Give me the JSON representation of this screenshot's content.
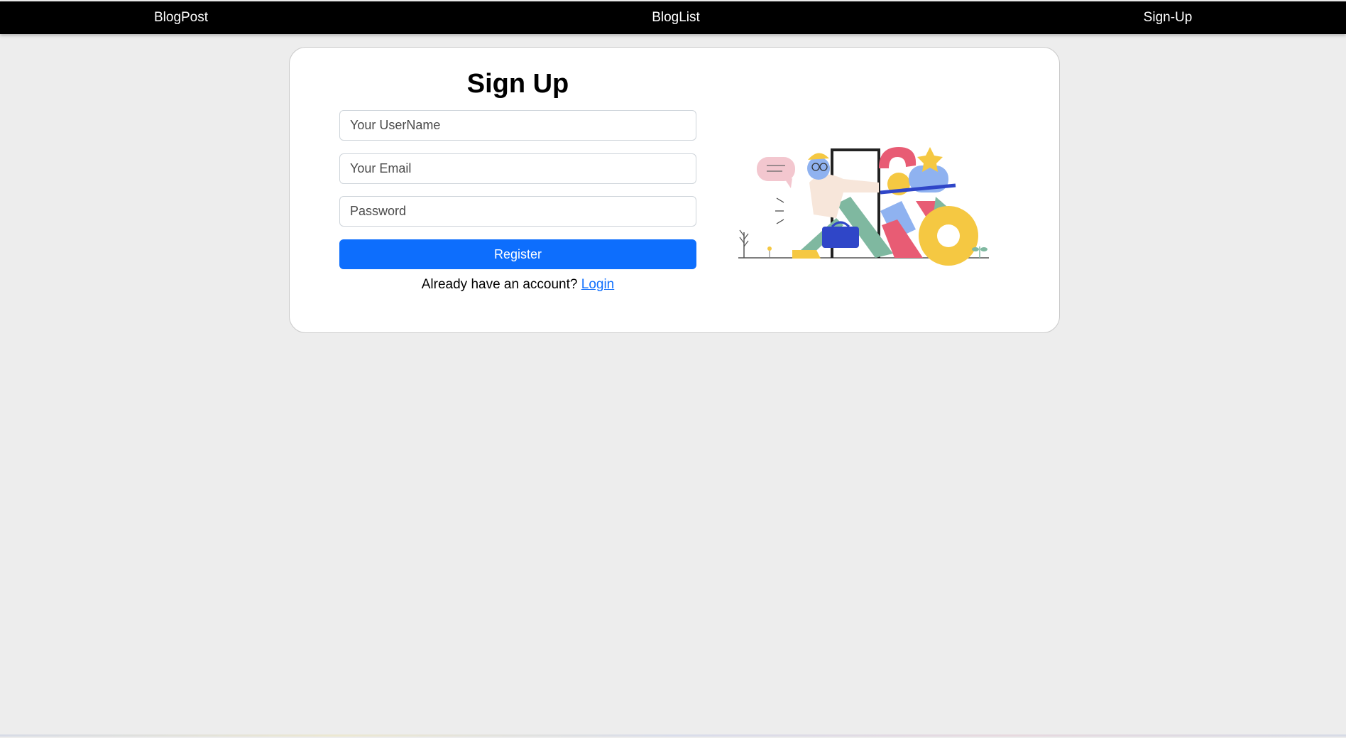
{
  "navbar": {
    "brand": "BlogPost",
    "link_bloglist": "BlogList",
    "link_signup": "Sign-Up"
  },
  "signup": {
    "title": "Sign Up",
    "username_placeholder": "Your UserName",
    "email_placeholder": "Your Email",
    "password_placeholder": "Password",
    "register_label": "Register",
    "account_prompt": "Already have an account?",
    "login_label": "Login"
  },
  "colors": {
    "navbar_bg": "#000000",
    "page_bg": "#ededed",
    "primary": "#0d6efd"
  }
}
